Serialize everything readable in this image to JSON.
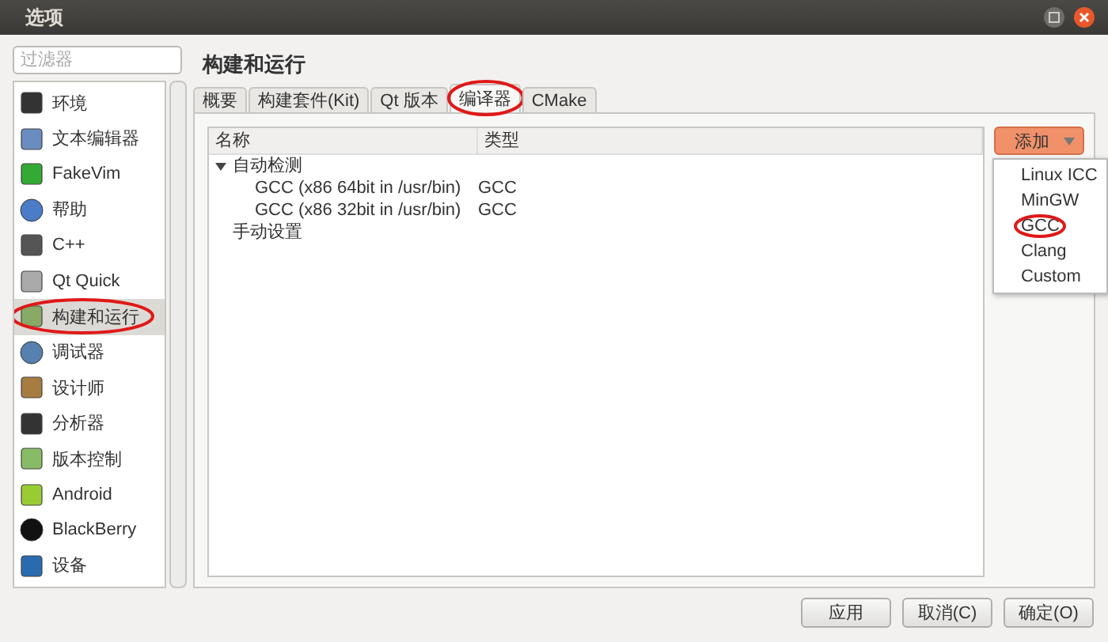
{
  "window": {
    "title": "选项"
  },
  "filter": {
    "placeholder": "过滤器"
  },
  "sidebar": {
    "items": [
      {
        "label": "环境",
        "selected": false,
        "circled": false
      },
      {
        "label": "文本编辑器",
        "selected": false,
        "circled": false
      },
      {
        "label": "FakeVim",
        "selected": false,
        "circled": false
      },
      {
        "label": "帮助",
        "selected": false,
        "circled": false
      },
      {
        "label": "C++",
        "selected": false,
        "circled": false
      },
      {
        "label": "Qt Quick",
        "selected": false,
        "circled": false
      },
      {
        "label": "构建和运行",
        "selected": true,
        "circled": true
      },
      {
        "label": "调试器",
        "selected": false,
        "circled": false
      },
      {
        "label": "设计师",
        "selected": false,
        "circled": false
      },
      {
        "label": "分析器",
        "selected": false,
        "circled": false
      },
      {
        "label": "版本控制",
        "selected": false,
        "circled": false
      },
      {
        "label": "Android",
        "selected": false,
        "circled": false
      },
      {
        "label": "BlackBerry",
        "selected": false,
        "circled": false
      },
      {
        "label": "设备",
        "selected": false,
        "circled": false
      }
    ]
  },
  "page_title": "构建和运行",
  "tabs": [
    {
      "label": "概要",
      "selected": false,
      "circled": false
    },
    {
      "label": "构建套件(Kit)",
      "selected": false,
      "circled": false
    },
    {
      "label": "Qt 版本",
      "selected": false,
      "circled": false
    },
    {
      "label": "编译器",
      "selected": true,
      "circled": true
    },
    {
      "label": "CMake",
      "selected": false,
      "circled": false
    }
  ],
  "table": {
    "columns": [
      "名称",
      "类型"
    ],
    "rows": [
      {
        "name": "自动检测",
        "type": "",
        "expanded": true,
        "children": [
          {
            "name": "GCC (x86 64bit in /usr/bin)",
            "type": "GCC"
          },
          {
            "name": "GCC (x86 32bit in /usr/bin)",
            "type": "GCC"
          }
        ]
      },
      {
        "name": "手动设置",
        "type": ""
      }
    ]
  },
  "add_button": {
    "label": "添加"
  },
  "add_menu": {
    "items": [
      {
        "label": "Linux ICC",
        "circled": false
      },
      {
        "label": "MinGW",
        "circled": false
      },
      {
        "label": "GCC",
        "circled": true
      },
      {
        "label": "Clang",
        "circled": false
      },
      {
        "label": "Custom",
        "circled": false
      }
    ]
  },
  "buttons": [
    "应用",
    "取消(C)",
    "确定(O)"
  ]
}
